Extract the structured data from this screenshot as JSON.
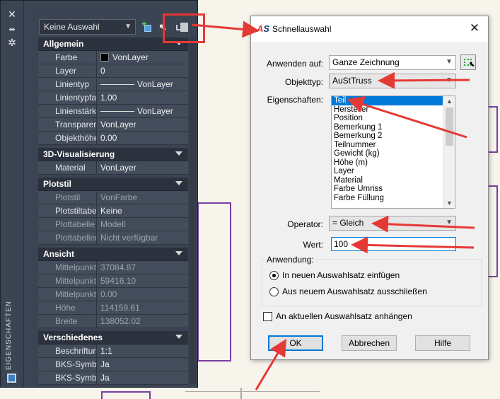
{
  "palette": {
    "title": "EIGENSCHAFTEN",
    "selection": "Keine Auswahl",
    "sections": [
      {
        "title": "Allgemein",
        "rows": [
          {
            "name": "Farbe",
            "value": "VonLayer",
            "kind": "color"
          },
          {
            "name": "Layer",
            "value": "0"
          },
          {
            "name": "Linientyp",
            "value": "VonLayer",
            "kind": "line"
          },
          {
            "name": "Linientypfak...",
            "value": "1.00"
          },
          {
            "name": "Linienstärke",
            "value": "VonLayer",
            "kind": "line"
          },
          {
            "name": "Transparenz",
            "value": "VonLayer"
          },
          {
            "name": "Objekthöhe",
            "value": "0.00"
          }
        ]
      },
      {
        "title": "3D-Visualisierung",
        "rows": [
          {
            "name": "Material",
            "value": "VonLayer"
          }
        ]
      },
      {
        "title": "Plotstil",
        "rows": [
          {
            "name": "Plotstil",
            "value": "VonFarbe",
            "dim": true
          },
          {
            "name": "Plotstiltabelle",
            "value": "Keine"
          },
          {
            "name": "Plottabelle z...",
            "value": "Modell",
            "dim": true
          },
          {
            "name": "Plottabellen...",
            "value": "Nicht verfügbar",
            "dim": true
          }
        ]
      },
      {
        "title": "Ansicht",
        "rows": [
          {
            "name": "Mittelpunkt X",
            "value": "37084.87",
            "dim": true
          },
          {
            "name": "Mittelpunkt Y",
            "value": "59416.10",
            "dim": true
          },
          {
            "name": "Mittelpunkt Z",
            "value": "0.00",
            "dim": true
          },
          {
            "name": "Höhe",
            "value": "114159.61",
            "dim": true
          },
          {
            "name": "Breite",
            "value": "138052.02",
            "dim": true
          }
        ]
      },
      {
        "title": "Verschiedenes",
        "rows": [
          {
            "name": "Beschriftun...",
            "value": "1:1"
          },
          {
            "name": "BKS-Symbol...",
            "value": "Ja"
          },
          {
            "name": "BKS-Symbol...",
            "value": "Ja"
          }
        ]
      }
    ]
  },
  "dialog": {
    "logo_a": "A",
    "logo_s": "S",
    "title": "Schnellauswahl",
    "apply_label": "Anwenden auf:",
    "apply_value": "Ganze Zeichnung",
    "objtype_label": "Objekttyp:",
    "objtype_value": "AuStTruss",
    "props_label": "Eigenschaften:",
    "properties": [
      "Teil",
      "Hersteller",
      "Position",
      "Bemerkung 1",
      "Bemerkung 2",
      "Teilnummer",
      "Gewicht (kg)",
      "Höhe (m)",
      "Layer",
      "Material",
      "Farbe Umriss",
      "Farbe Füllung"
    ],
    "operator_label": "Operator:",
    "operator_value": "= Gleich",
    "value_label": "Wert:",
    "value_value": "100",
    "apply_group_label": "Anwendung:",
    "radio_include": "In neuen Auswahlsatz einfügen",
    "radio_exclude": "Aus neuem Auswahlsatz ausschließen",
    "append_checkbox": "An aktuellen Auswahlsatz anhängen",
    "ok": "OK",
    "cancel": "Abbrechen",
    "help": "Hilfe"
  },
  "colors": {
    "annotation_red": "#e53935",
    "palette_bg": "#3b4453",
    "selection_blue": "#0078d7",
    "cad_purple": "#7a3fa0"
  }
}
